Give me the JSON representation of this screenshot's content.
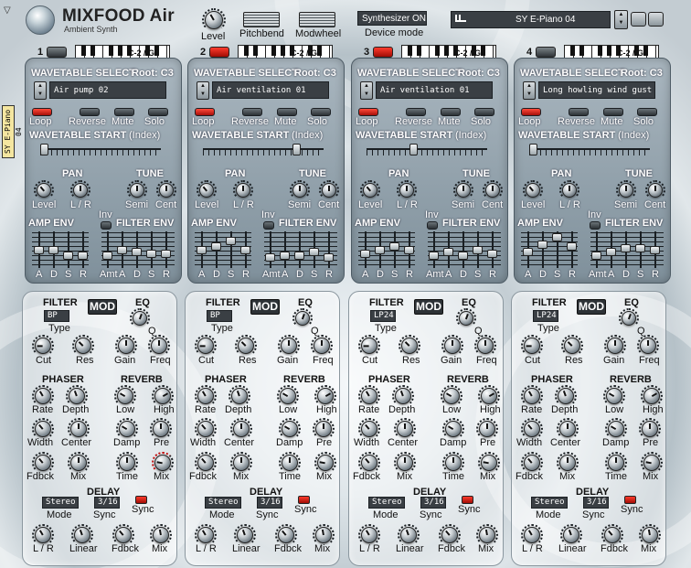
{
  "header": {
    "title": "MIXFOOD Air",
    "subtitle": "Ambient Synth",
    "level_label": "Level",
    "pitchbend_label": "Pitchbend",
    "modwheel_label": "Modwheel",
    "device_mode_display": "Synthesizer ON",
    "device_mode_label": "Device mode",
    "preset_name": "SY E-Piano 04"
  },
  "side_tab": "SY E-Piano 04",
  "labels": {
    "range": "C-2 / G8",
    "wavetable_select": "WAVETABLE SELECT",
    "loop": "Loop",
    "reverse": "Reverse",
    "mute": "Mute",
    "solo": "Solo",
    "wavetable_start": "WAVETABLE START",
    "index": "(Index)",
    "pan": "PAN",
    "tune": "TUNE",
    "level": "Level",
    "lr": "L / R",
    "semi": "Semi",
    "cent": "Cent",
    "amp_env": "AMP ENV",
    "inv": "Inv",
    "filter_env": "FILTER ENV",
    "a": "A",
    "d": "D",
    "s": "S",
    "r": "R",
    "amt": "Amt",
    "filter": "FILTER",
    "mod": "MOD",
    "eq": "EQ",
    "type": "Type",
    "q": "Q",
    "cut": "Cut",
    "res": "Res",
    "gain": "Gain",
    "freq": "Freq",
    "phaser": "PHASER",
    "reverb": "REVERB",
    "rate": "Rate",
    "depth": "Depth",
    "low": "Low",
    "high": "High",
    "width": "Width",
    "center": "Center",
    "damp": "Damp",
    "pre": "Pre",
    "fdbck": "Fdbck",
    "mix": "Mix",
    "time": "Time",
    "delay": "DELAY",
    "mode": "Mode",
    "sync": "Sync",
    "linear": "Linear",
    "lr2": "L / R"
  },
  "channels": [
    {
      "number": "1",
      "root": "Root: C3",
      "wavetable": "Air pump 02",
      "filter_type": "BP",
      "delay_mode": "Stereo",
      "delay_sync": "3/16",
      "led_on": false
    },
    {
      "number": "2",
      "root": "Root: C3",
      "wavetable": "Air ventilation 01",
      "filter_type": "BP",
      "delay_mode": "Stereo",
      "delay_sync": "3/16",
      "led_on": true
    },
    {
      "number": "3",
      "root": "Root: C3",
      "wavetable": "Air ventilation 01",
      "filter_type": "LP24",
      "delay_mode": "Stereo",
      "delay_sync": "3/16",
      "led_on": true
    },
    {
      "number": "4",
      "root": "Root: C3",
      "wavetable": "Long howling wind gust",
      "filter_type": "LP24",
      "delay_mode": "Stereo",
      "delay_sync": "3/16",
      "led_on": false
    }
  ],
  "colors": {
    "panel": "#8fa0ab",
    "led_on": "#e02418",
    "display_bg": "#3a3f44"
  }
}
